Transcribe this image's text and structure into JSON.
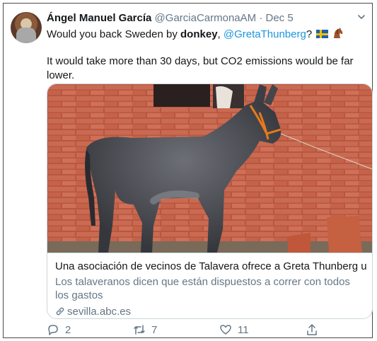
{
  "tweet": {
    "author_name": "Ángel Manuel García",
    "handle": "@GarciaCarmonaAM",
    "separator": "·",
    "date": "Dec 5",
    "text_line1_pre": "Would you back Sweden by ",
    "text_bold": "donkey",
    "text_line1_comma": ", ",
    "mention": "@GretaThunberg",
    "text_q": "?",
    "text_para2": "It would take more than 30 days, but CO2 emissions would be far lower."
  },
  "card": {
    "title": "Una asociación de vecinos de Talavera ofrece a Greta Thunberg u...",
    "description": "Los talaveranos dicen que están dispuestos a correr con todos los gastos",
    "domain": "sevilla.abc.es"
  },
  "actions": {
    "reply_count": "2",
    "retweet_count": "7",
    "like_count": "11"
  },
  "colors": {
    "link": "#1b95e0",
    "secondary_text": "#657786",
    "border": "#ccd6dd"
  },
  "icons": [
    "chevron-down-icon",
    "sweden-flag-icon",
    "horse-icon",
    "link-icon",
    "reply-icon",
    "retweet-icon",
    "like-icon",
    "share-icon"
  ]
}
